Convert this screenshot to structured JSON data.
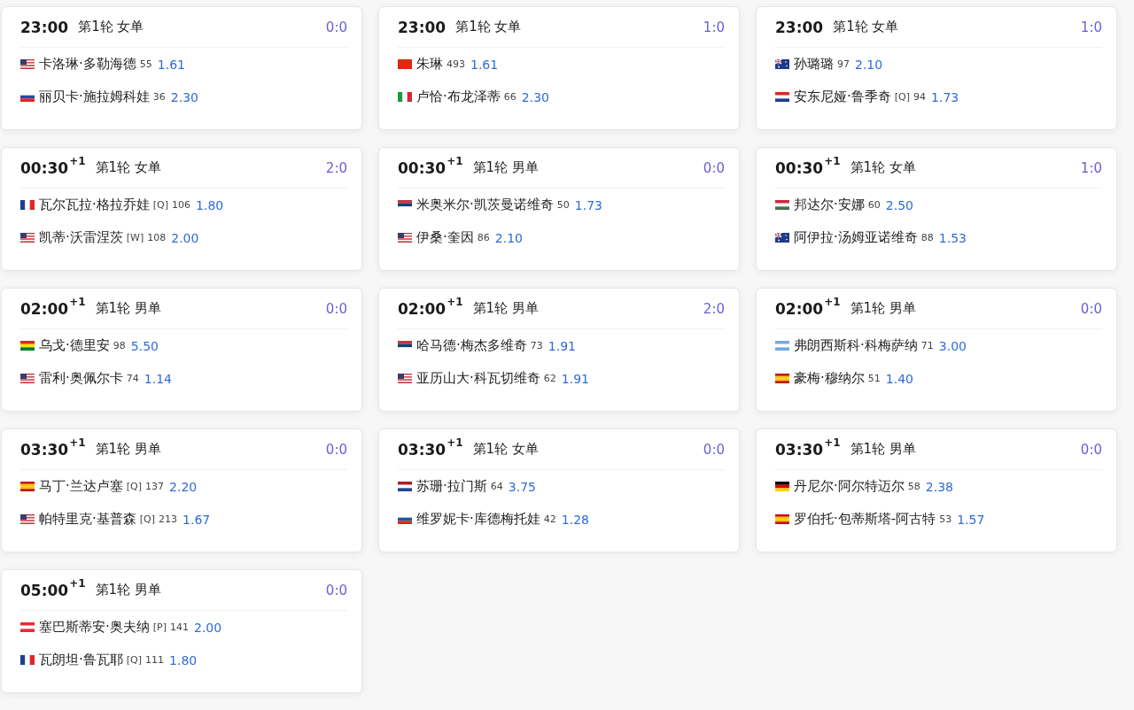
{
  "matches": [
    {
      "time": "23:00",
      "round": "第1轮 女单",
      "score": "0:0",
      "players": [
        {
          "kind": "us",
          "name": "卡洛琳·多勒海德",
          "rank": "55",
          "odds": "1.61"
        },
        {
          "kind": "sk",
          "name": "丽贝卡·施拉姆科娃",
          "rank": "36",
          "odds": "2.30"
        }
      ]
    },
    {
      "time": "23:00",
      "round": "第1轮 女单",
      "score": "1:0",
      "players": [
        {
          "kind": "cn",
          "name": "朱琳",
          "rank": "493",
          "odds": "1.61"
        },
        {
          "kind": "it",
          "name": "卢恰·布龙泽蒂",
          "rank": "66",
          "odds": "2.30"
        }
      ]
    },
    {
      "time": "23:00",
      "round": "第1轮 女单",
      "score": "1:0",
      "players": [
        {
          "kind": "nz",
          "name": "孙璐璐",
          "rank": "97",
          "odds": "2.10"
        },
        {
          "kind": "hr",
          "name": "安东尼娅·鲁季奇",
          "tag": "[Q]",
          "rank": "94",
          "odds": "1.73"
        }
      ]
    },
    {
      "time": "00:30",
      "day_offset": "+1",
      "round": "第1轮 女单",
      "score": "2:0",
      "players": [
        {
          "kind": "fr",
          "name": "瓦尔瓦拉·格拉乔娃",
          "tag": "[Q]",
          "rank": "106",
          "odds": "1.80"
        },
        {
          "kind": "us",
          "name": "凯蒂·沃雷涅茨",
          "tag": "[W]",
          "rank": "108",
          "odds": "2.00"
        }
      ]
    },
    {
      "time": "00:30",
      "day_offset": "+1",
      "round": "第1轮 男单",
      "score": "0:0",
      "players": [
        {
          "kind": "rs",
          "name": "米奥米尔·凯茨曼诺维奇",
          "rank": "50",
          "odds": "1.73"
        },
        {
          "kind": "us",
          "name": "伊桑·奎因",
          "rank": "86",
          "odds": "2.10"
        }
      ]
    },
    {
      "time": "00:30",
      "day_offset": "+1",
      "round": "第1轮 女单",
      "score": "1:0",
      "players": [
        {
          "kind": "hu",
          "name": "邦达尔·安娜",
          "rank": "60",
          "odds": "2.50"
        },
        {
          "kind": "au",
          "name": "阿伊拉·汤姆亚诺维奇",
          "rank": "88",
          "odds": "1.53"
        }
      ]
    },
    {
      "time": "02:00",
      "day_offset": "+1",
      "round": "第1轮 男单",
      "score": "0:0",
      "players": [
        {
          "kind": "bo",
          "name": "乌戈·德里安",
          "rank": "98",
          "odds": "5.50"
        },
        {
          "kind": "us",
          "name": "雷利·奥佩尔卡",
          "rank": "74",
          "odds": "1.14"
        }
      ]
    },
    {
      "time": "02:00",
      "day_offset": "+1",
      "round": "第1轮 男单",
      "score": "2:0",
      "players": [
        {
          "kind": "rs",
          "name": "哈马德·梅杰多维奇",
          "rank": "73",
          "odds": "1.91"
        },
        {
          "kind": "us",
          "name": "亚历山大·科瓦切维奇",
          "rank": "62",
          "odds": "1.91"
        }
      ]
    },
    {
      "time": "02:00",
      "day_offset": "+1",
      "round": "第1轮 男单",
      "score": "0:0",
      "players": [
        {
          "kind": "ar",
          "name": "弗朗西斯科·科梅萨纳",
          "rank": "71",
          "odds": "3.00"
        },
        {
          "kind": "es",
          "name": "豪梅·穆纳尔",
          "rank": "51",
          "odds": "1.40"
        }
      ]
    },
    {
      "time": "03:30",
      "day_offset": "+1",
      "round": "第1轮 男单",
      "score": "0:0",
      "players": [
        {
          "kind": "es",
          "name": "马丁·兰达卢塞",
          "tag": "[Q]",
          "rank": "137",
          "odds": "2.20"
        },
        {
          "kind": "us",
          "name": "帕特里克·基普森",
          "tag": "[Q]",
          "rank": "213",
          "odds": "1.67"
        }
      ]
    },
    {
      "time": "03:30",
      "day_offset": "+1",
      "round": "第1轮 女单",
      "score": "0:0",
      "players": [
        {
          "kind": "nl",
          "name": "苏珊·拉门斯",
          "rank": "64",
          "odds": "3.75"
        },
        {
          "kind": "ru",
          "name": "维罗妮卡·库德梅托娃",
          "rank": "42",
          "odds": "1.28"
        }
      ]
    },
    {
      "time": "03:30",
      "day_offset": "+1",
      "round": "第1轮 男单",
      "score": "0:0",
      "players": [
        {
          "kind": "de",
          "name": "丹尼尔·阿尔特迈尔",
          "rank": "58",
          "odds": "2.38"
        },
        {
          "kind": "es",
          "name": "罗伯托·包蒂斯塔-阿古特",
          "rank": "53",
          "odds": "1.57"
        }
      ]
    },
    {
      "time": "05:00",
      "day_offset": "+1",
      "round": "第1轮 男单",
      "score": "0:0",
      "players": [
        {
          "kind": "at",
          "name": "塞巴斯蒂安·奥夫纳",
          "tag": "[P]",
          "rank": "141",
          "odds": "2.00"
        },
        {
          "kind": "fr",
          "name": "瓦朗坦·鲁瓦耶",
          "tag": "[Q]",
          "rank": "111",
          "odds": "1.80"
        }
      ]
    }
  ]
}
